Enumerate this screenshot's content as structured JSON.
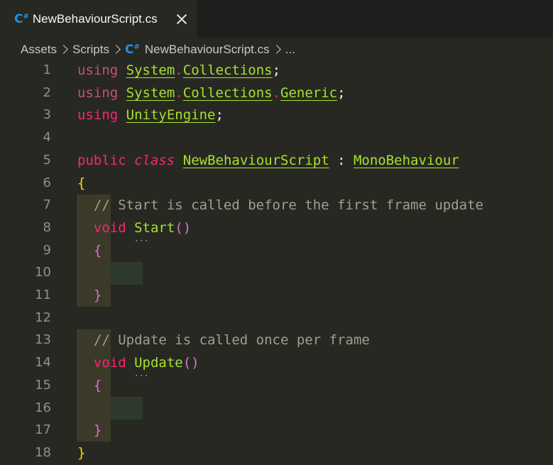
{
  "tab": {
    "icon": "csharp-file-icon",
    "title": "NewBehaviourScript.cs"
  },
  "breadcrumb": {
    "items": [
      "Assets",
      "Scripts",
      "NewBehaviourScript.cs",
      "..."
    ]
  },
  "code": {
    "line_numbers": [
      "1",
      "2",
      "3",
      "4",
      "5",
      "6",
      "7",
      "8",
      "9",
      "10",
      "11",
      "12",
      "13",
      "14",
      "15",
      "16",
      "17",
      "18"
    ],
    "lines": [
      {
        "tokens": [
          [
            "kw-dim",
            "using"
          ],
          [
            "punc",
            " "
          ],
          [
            "ns",
            "System"
          ],
          [
            "dot",
            "."
          ],
          [
            "ns",
            "Collections"
          ],
          [
            "punc",
            ";"
          ]
        ]
      },
      {
        "tokens": [
          [
            "kw-dim",
            "using"
          ],
          [
            "punc",
            " "
          ],
          [
            "ns",
            "System"
          ],
          [
            "dot",
            "."
          ],
          [
            "ns",
            "Collections"
          ],
          [
            "dot",
            "."
          ],
          [
            "ns",
            "Generic"
          ],
          [
            "punc",
            ";"
          ]
        ]
      },
      {
        "tokens": [
          [
            "kw",
            "using"
          ],
          [
            "punc",
            " "
          ],
          [
            "ns",
            "UnityEngine"
          ],
          [
            "punc",
            ";"
          ]
        ]
      },
      {
        "tokens": []
      },
      {
        "tokens": [
          [
            "kw",
            "public"
          ],
          [
            "punc",
            " "
          ],
          [
            "kw italic",
            "class"
          ],
          [
            "punc",
            " "
          ],
          [
            "type",
            "NewBehaviourScript"
          ],
          [
            "punc",
            " : "
          ],
          [
            "type",
            "MonoBehaviour"
          ]
        ]
      },
      {
        "tokens": [
          [
            "brace-y",
            "{"
          ]
        ]
      },
      {
        "tokens": [
          [
            "punc",
            "  "
          ],
          [
            "comment",
            "// Start is called before the first frame update"
          ]
        ]
      },
      {
        "tokens": [
          [
            "punc",
            "  "
          ],
          [
            "kw",
            "void"
          ],
          [
            "punc",
            " "
          ],
          [
            "fn fn-dots",
            "Start"
          ],
          [
            "brace-p",
            "()"
          ]
        ]
      },
      {
        "tokens": [
          [
            "punc",
            "  "
          ],
          [
            "brace-p",
            "{"
          ]
        ]
      },
      {
        "tokens": []
      },
      {
        "tokens": [
          [
            "punc",
            "  "
          ],
          [
            "brace-p",
            "}"
          ]
        ]
      },
      {
        "tokens": []
      },
      {
        "tokens": [
          [
            "punc",
            "  "
          ],
          [
            "comment",
            "// Update is called once per frame"
          ]
        ]
      },
      {
        "tokens": [
          [
            "punc",
            "  "
          ],
          [
            "kw",
            "void"
          ],
          [
            "punc",
            " "
          ],
          [
            "fn fn-dots",
            "Update"
          ],
          [
            "brace-p",
            "()"
          ]
        ]
      },
      {
        "tokens": [
          [
            "punc",
            "  "
          ],
          [
            "brace-p",
            "{"
          ]
        ]
      },
      {
        "tokens": []
      },
      {
        "tokens": [
          [
            "punc",
            "  "
          ],
          [
            "brace-p",
            "}"
          ]
        ]
      },
      {
        "tokens": [
          [
            "brace-y",
            "}"
          ]
        ]
      }
    ]
  }
}
